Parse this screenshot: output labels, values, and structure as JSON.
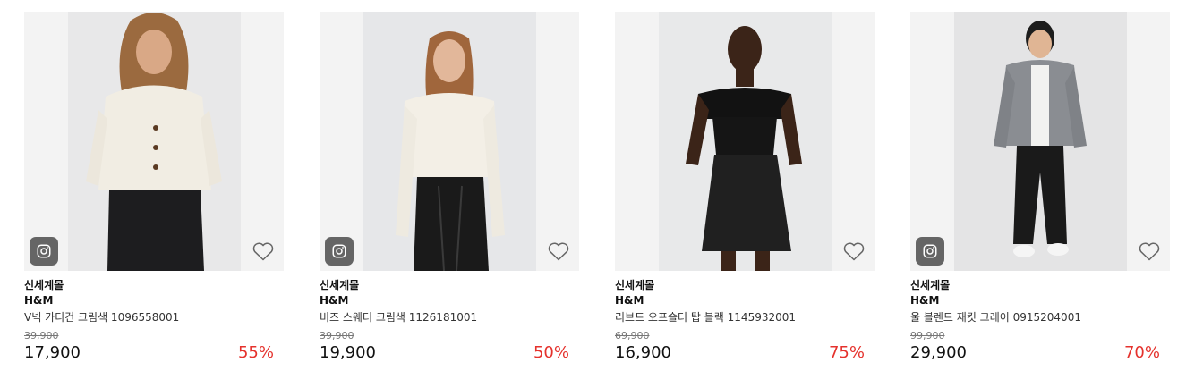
{
  "products": [
    {
      "mall": "신세계몰",
      "brand": "H&M",
      "name": "V넥 가디건 크림색 1096558001",
      "original_price": "39,900",
      "price": "17,900",
      "discount": "55%",
      "badge_icon": "instagram-icon",
      "wishlist_icon": "heart-outline-icon"
    },
    {
      "mall": "신세계몰",
      "brand": "H&M",
      "name": "비즈 스웨터 크림색 1126181001",
      "original_price": "39,900",
      "price": "19,900",
      "discount": "50%",
      "badge_icon": "instagram-icon",
      "wishlist_icon": "heart-outline-icon"
    },
    {
      "mall": "신세계몰",
      "brand": "H&M",
      "name": "리브드 오프숄더 탑 블랙 1145932001",
      "original_price": "69,900",
      "price": "16,900",
      "discount": "75%",
      "badge_icon": "instagram-icon",
      "wishlist_icon": "heart-outline-icon"
    },
    {
      "mall": "신세계몰",
      "brand": "H&M",
      "name": "울 블렌드 재킷 그레이 0915204001",
      "original_price": "99,900",
      "price": "29,900",
      "discount": "70%",
      "badge_icon": "instagram-icon",
      "wishlist_icon": "heart-outline-icon"
    }
  ],
  "colors": {
    "discount": "#e5322d",
    "badge_bg": "#5a5a5a",
    "thumb_bg": "#f3f3f3"
  }
}
